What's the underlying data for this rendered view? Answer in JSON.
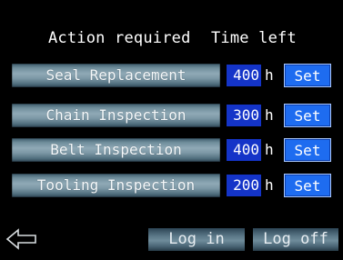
{
  "header": {
    "action_label": "Action required",
    "time_label": "Time left"
  },
  "rows": [
    {
      "task": "Seal Replacement",
      "hours": "400",
      "unit": "h",
      "set_label": "Set"
    },
    {
      "task": "Chain Inspection",
      "hours": "300",
      "unit": "h",
      "set_label": "Set"
    },
    {
      "task": "Belt Inspection",
      "hours": "400",
      "unit": "h",
      "set_label": "Set"
    },
    {
      "task": "Tooling Inspection",
      "hours": "200",
      "unit": "h",
      "set_label": "Set"
    }
  ],
  "footer": {
    "back_icon": "back-arrow-icon",
    "login_label": "Log in",
    "logoff_label": "Log off"
  },
  "colors": {
    "background": "#000000",
    "value_bg": "#1434c8",
    "set_button": "#1e6cf0"
  }
}
